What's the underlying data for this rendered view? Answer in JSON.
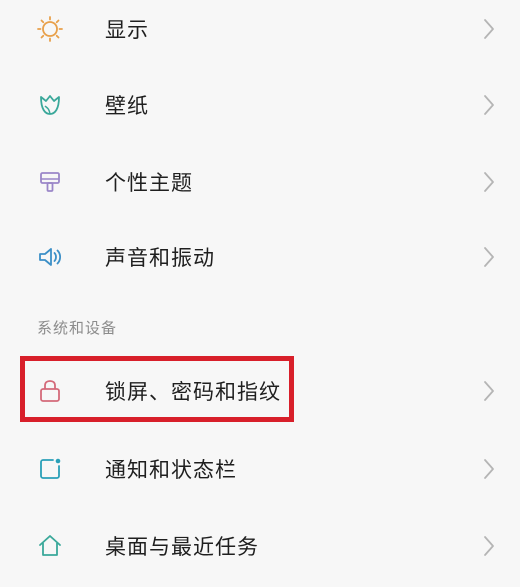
{
  "settings": {
    "section_header": "系统和设备",
    "items": [
      {
        "label": "显示",
        "icon": "sun-icon",
        "color": "#e8a04a"
      },
      {
        "label": "壁纸",
        "icon": "tulip-icon",
        "color": "#3aa89a"
      },
      {
        "label": "个性主题",
        "icon": "paint-brush-icon",
        "color": "#9a86c8"
      },
      {
        "label": "声音和振动",
        "icon": "speaker-icon",
        "color": "#3c8fc7"
      },
      {
        "label": "锁屏、密码和指纹",
        "icon": "lock-icon",
        "color": "#d46a7a"
      },
      {
        "label": "通知和状态栏",
        "icon": "notification-icon",
        "color": "#2aa0b8"
      },
      {
        "label": "桌面与最近任务",
        "icon": "home-icon",
        "color": "#3aa89a"
      }
    ],
    "highlight_color": "#d81f2a"
  }
}
